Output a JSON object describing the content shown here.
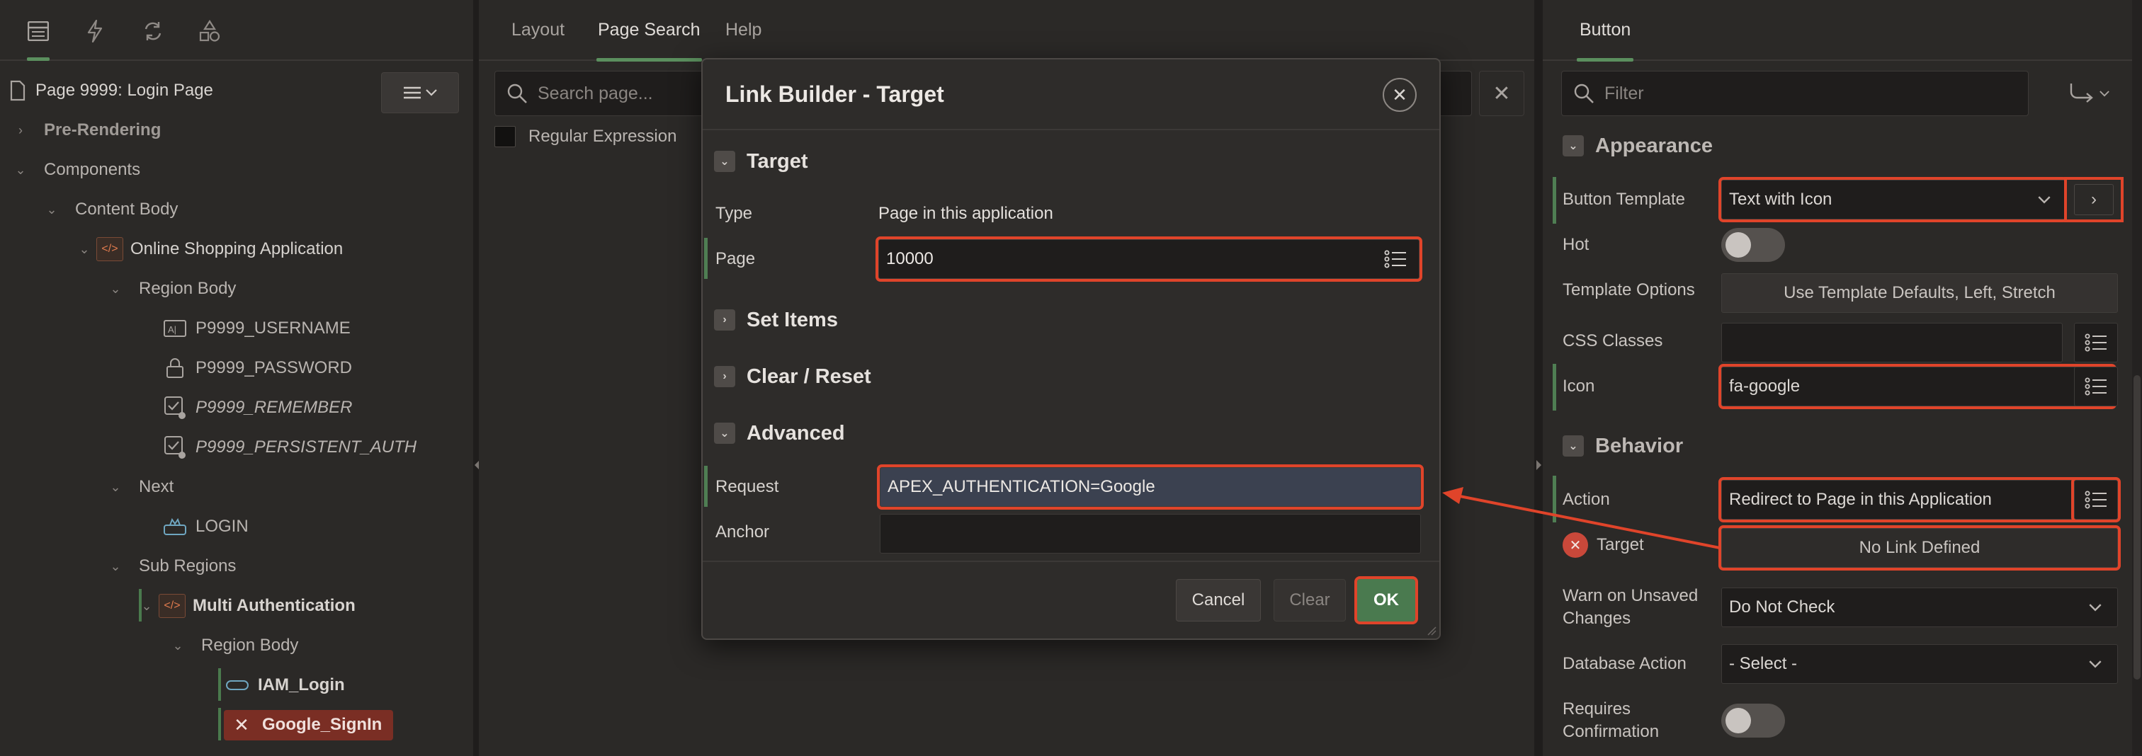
{
  "left": {
    "page_title": "Page 9999: Login Page",
    "tree": [
      {
        "label": "Pre-Rendering"
      },
      {
        "label": "Components"
      },
      {
        "label": "Content Body"
      },
      {
        "label": "Online Shopping Application"
      },
      {
        "label": "Region Body"
      },
      {
        "label": "P9999_USERNAME"
      },
      {
        "label": "P9999_PASSWORD"
      },
      {
        "label": "P9999_REMEMBER"
      },
      {
        "label": "P9999_PERSISTENT_AUTH"
      },
      {
        "label": "Next"
      },
      {
        "label": "LOGIN"
      },
      {
        "label": "Sub Regions"
      },
      {
        "label": "Multi Authentication"
      },
      {
        "label": "Region Body"
      },
      {
        "label": "IAM_Login"
      },
      {
        "label": "Google_SignIn"
      }
    ]
  },
  "center": {
    "tabs": [
      "Layout",
      "Page Search",
      "Help"
    ],
    "search_placeholder": "Search page...",
    "regex_label": "Regular Expression"
  },
  "dialog": {
    "title": "Link Builder - Target",
    "sections": {
      "target": "Target",
      "set_items": "Set Items",
      "clear_reset": "Clear / Reset",
      "advanced": "Advanced"
    },
    "type_label": "Type",
    "type_value": "Page in this application",
    "page_label": "Page",
    "page_value": "10000",
    "request_label": "Request",
    "request_value": "APEX_AUTHENTICATION=Google",
    "anchor_label": "Anchor",
    "anchor_value": "",
    "buttons": {
      "cancel": "Cancel",
      "clear": "Clear",
      "ok": "OK"
    }
  },
  "right": {
    "tab": "Button",
    "filter_placeholder": "Filter",
    "appearance": "Appearance",
    "button_template_label": "Button Template",
    "button_template_value": "Text with Icon",
    "hot_label": "Hot",
    "template_options_label": "Template Options",
    "template_options_value": "Use Template Defaults, Left, Stretch",
    "css_classes_label": "CSS Classes",
    "icon_label": "Icon",
    "icon_value": "fa-google",
    "behavior": "Behavior",
    "action_label": "Action",
    "action_value": "Redirect to Page in this Application",
    "target_label": "Target",
    "target_value": "No Link Defined",
    "warn_label": "Warn on Unsaved Changes",
    "warn_value": "Do Not Check",
    "db_action_label": "Database Action",
    "db_action_value": "- Select -",
    "requires_confirm_label": "Requires Confirmation"
  },
  "colors": {
    "highlight": "#e0442a",
    "ok": "#4a7a4f",
    "selected": "#7a2e24",
    "accent": "#5b8f5e"
  }
}
